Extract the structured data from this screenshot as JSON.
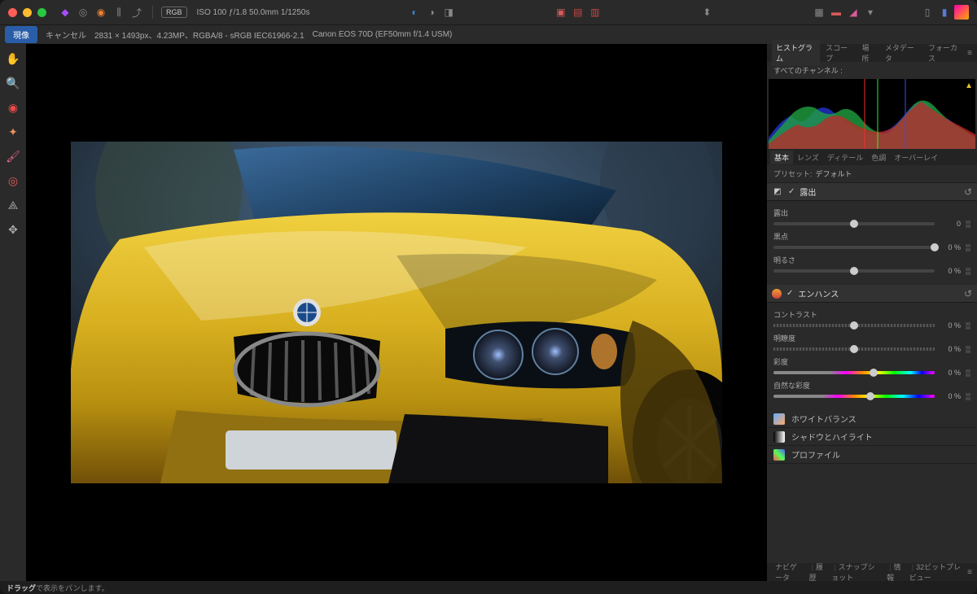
{
  "titlebar": {
    "rgb_badge": "RGB",
    "exif": "ISO 100 ƒ/1.8 50.0mm 1/1250s"
  },
  "contextbar": {
    "develop": "現像",
    "cancel": "キャンセル",
    "dimensions": "2831 × 1493px、4.23MP、RGBA/8 - sRGB IEC61966-2.1",
    "camera": "Canon EOS 70D (EF50mm f/1.4 USM)"
  },
  "rpanel": {
    "tabs": [
      "ヒストグラム",
      "スコープ",
      "場所",
      "メタデータ",
      "フォーカス"
    ],
    "histo_title": "すべてのチャンネル :",
    "subtabs": [
      "基本",
      "レンズ",
      "ディテール",
      "色調",
      "オーバーレイ"
    ],
    "preset_label": "プリセット:",
    "preset_value": "デフォルト",
    "exposure": {
      "title": "露出",
      "sliders": [
        {
          "label": "露出",
          "value": "0",
          "pos": 50
        },
        {
          "label": "黒点",
          "value": "0 %",
          "pos": 100
        },
        {
          "label": "明るさ",
          "value": "0 %",
          "pos": 50
        }
      ]
    },
    "enhance": {
      "title": "エンハンス",
      "sliders": [
        {
          "label": "コントラスト",
          "value": "0 %",
          "pos": 50,
          "style": "wavy"
        },
        {
          "label": "明瞭度",
          "value": "0 %",
          "pos": 50,
          "style": "wavy"
        },
        {
          "label": "彩度",
          "value": "0 %",
          "pos": 62,
          "style": "grad-sat"
        },
        {
          "label": "自然な彩度",
          "value": "0 %",
          "pos": 60,
          "style": "grad-vib"
        }
      ]
    },
    "collapsed": [
      {
        "name": "ホワイトバランス",
        "icon": "wb"
      },
      {
        "name": "シャドウとハイライト",
        "icon": "sh"
      },
      {
        "name": "プロファイル",
        "icon": "pf"
      }
    ],
    "bottom_tabs": [
      "ナビゲータ",
      "履歴",
      "スナップショット",
      "情報",
      "32ビットプレビュー"
    ]
  },
  "statusbar": {
    "drag_bold": "ドラッグ",
    "drag_rest": "で表示をパンします。"
  },
  "colors": {
    "traffic": [
      "#ff5f57",
      "#febc2e",
      "#28c840"
    ]
  }
}
